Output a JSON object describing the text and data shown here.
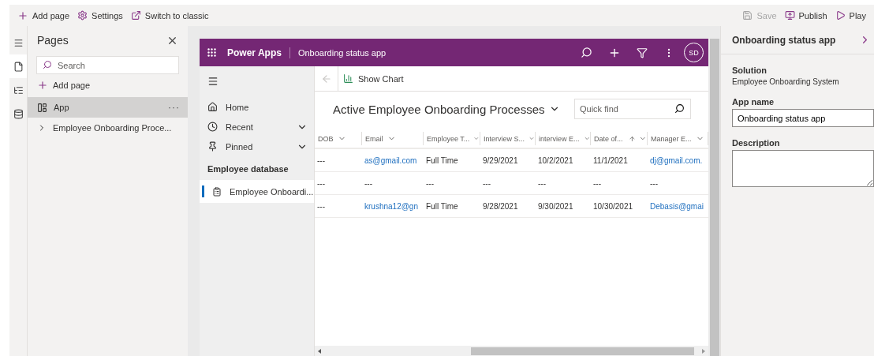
{
  "toolbar": {
    "left": [
      {
        "kind": "add",
        "label": "Add page"
      },
      {
        "kind": "settings",
        "label": "Settings"
      },
      {
        "kind": "switch",
        "label": "Switch to classic"
      }
    ],
    "right": [
      {
        "kind": "save",
        "label": "Save",
        "disabled": true
      },
      {
        "kind": "publish",
        "label": "Publish",
        "disabled": false
      },
      {
        "kind": "play",
        "label": "Play",
        "disabled": false
      }
    ]
  },
  "rail": [
    {
      "kind": "menu",
      "selected": false
    },
    {
      "kind": "pages",
      "selected": true
    },
    {
      "kind": "tree",
      "selected": false
    },
    {
      "kind": "data",
      "selected": false
    }
  ],
  "pages_panel": {
    "title": "Pages",
    "search": {
      "placeholder": "Search"
    },
    "add_label": "Add page",
    "items": [
      {
        "kind": "app",
        "label": "App",
        "selected": true,
        "more": "···"
      },
      {
        "kind": "page",
        "label": "Employee Onboarding Proce...",
        "selected": false,
        "expanded": false
      }
    ]
  },
  "app": {
    "brand": "Power Apps",
    "title": "Onboarding status app",
    "avatar": "SD",
    "nav": [
      {
        "kind": "home",
        "label": "Home"
      },
      {
        "kind": "recent",
        "label": "Recent",
        "expanded": false
      },
      {
        "kind": "pinned",
        "label": "Pinned",
        "expanded": false
      }
    ],
    "group": "Employee database",
    "entities": [
      {
        "label": "Employee Onboardi...",
        "selected": true
      }
    ],
    "command": "Show Chart",
    "view_title": "Active Employee Onboarding Processes",
    "quick_find": {
      "placeholder": "Quick find"
    },
    "columns": [
      {
        "label": "DOB",
        "sorted": false
      },
      {
        "label": "Email",
        "sorted": false
      },
      {
        "label": "Employee T...",
        "sorted": false
      },
      {
        "label": "Interview S...",
        "sorted": false
      },
      {
        "label": "interview E...",
        "sorted": false
      },
      {
        "label": "Date of...",
        "sorted": true
      },
      {
        "label": "Manager E...",
        "sorted": false
      }
    ],
    "rows": [
      [
        {
          "text": "---",
          "link": false
        },
        {
          "text": "as@gmail.com",
          "link": true
        },
        {
          "text": "Full Time",
          "link": false
        },
        {
          "text": "9/29/2021",
          "link": false
        },
        {
          "text": "10/2/2021",
          "link": false
        },
        {
          "text": "11/1/2021",
          "link": false
        },
        {
          "text": "dj@gmail.com.",
          "link": true
        }
      ],
      [
        {
          "text": "---",
          "link": false
        },
        {
          "text": "---",
          "link": false
        },
        {
          "text": "---",
          "link": false
        },
        {
          "text": "---",
          "link": false
        },
        {
          "text": "---",
          "link": false
        },
        {
          "text": "---",
          "link": false
        },
        {
          "text": "---",
          "link": false
        }
      ],
      [
        {
          "text": "---",
          "link": false
        },
        {
          "text": "krushna12@gn",
          "link": true
        },
        {
          "text": "Full Time",
          "link": false
        },
        {
          "text": "9/28/2021",
          "link": false
        },
        {
          "text": "9/30/2021",
          "link": false
        },
        {
          "text": "10/30/2021",
          "link": false
        },
        {
          "text": "Debasis@gmai",
          "link": true
        }
      ]
    ]
  },
  "properties": {
    "title": "Onboarding status app",
    "solution_label": "Solution",
    "solution": "Employee Onboarding System",
    "name_label": "App name",
    "name_value": "Onboarding status app",
    "description_label": "Description"
  }
}
